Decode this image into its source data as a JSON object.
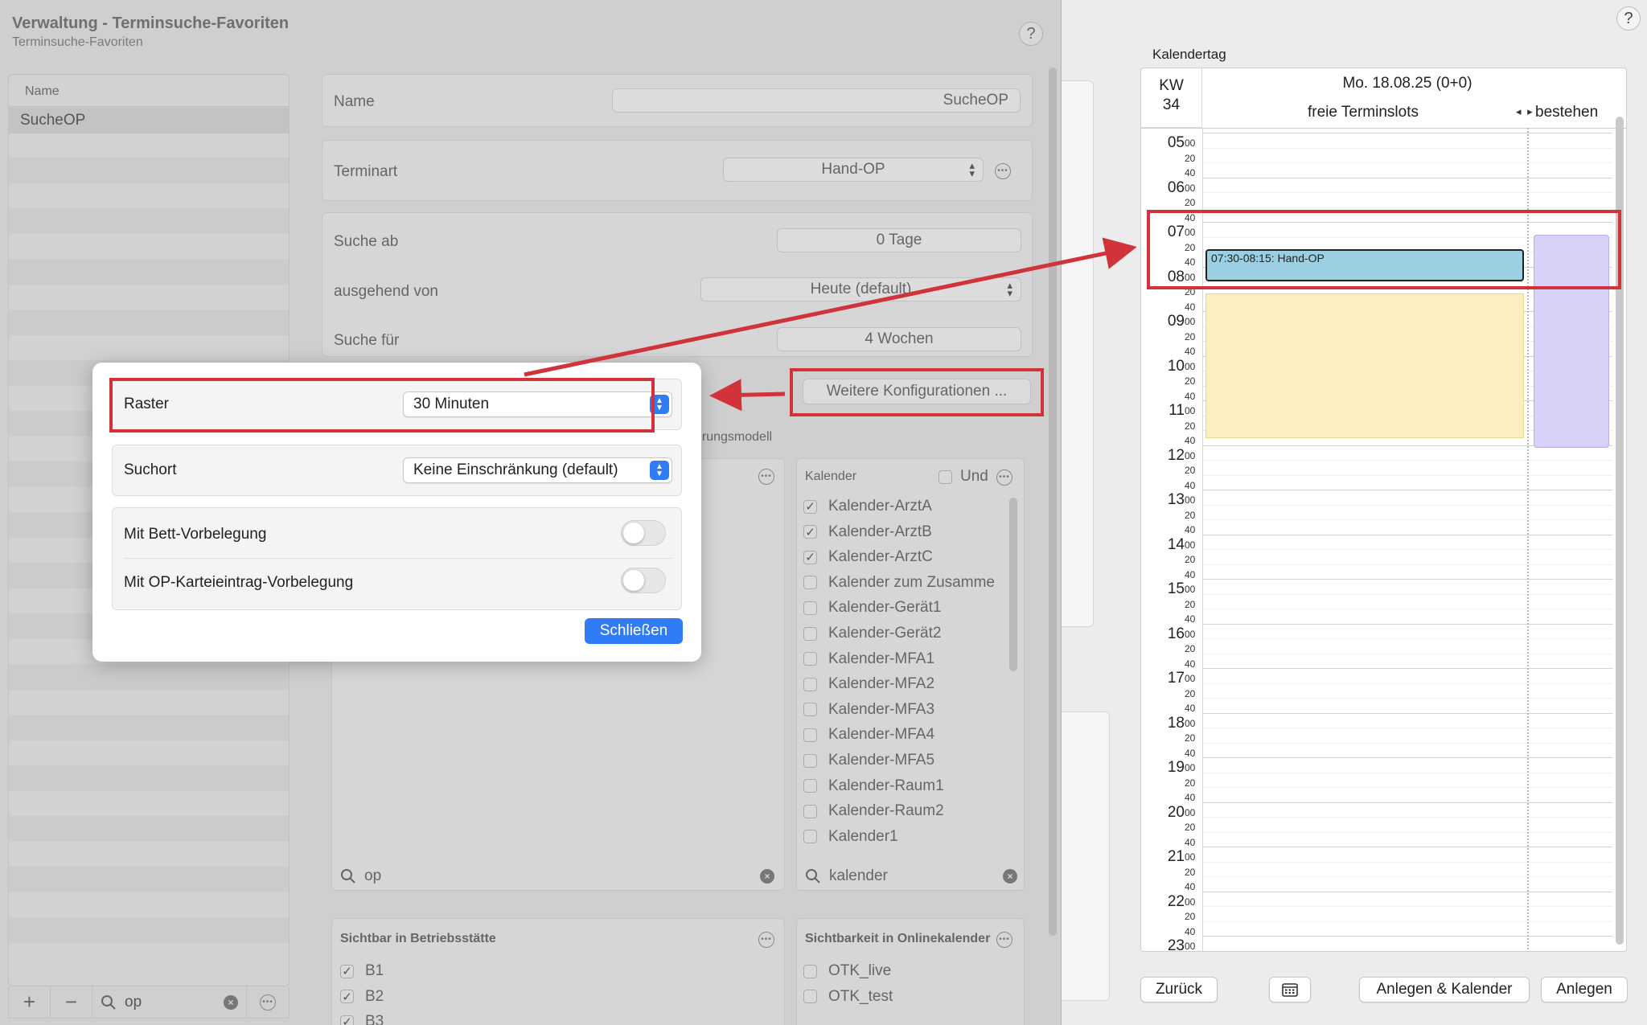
{
  "sheet": {
    "title": "Verwaltung - Terminsuche-Favoriten",
    "subtitle": "Terminsuche-Favoriten",
    "help": "?"
  },
  "list": {
    "header": "Name",
    "selected_item": "SucheOP",
    "search_value": "op",
    "add_label": "+",
    "remove_label": "−"
  },
  "form": {
    "name_label": "Name",
    "name_value": "SucheOP",
    "terminart_label": "Terminart",
    "terminart_value": "Hand-OP",
    "suche_ab_label": "Suche ab",
    "suche_ab_value": "0 Tage",
    "ausgehend_label": "ausgehend von",
    "ausgehend_value": "Heute (default)",
    "suche_fuer_label": "Suche für",
    "suche_fuer_value": "4 Wochen",
    "weitere_button": "Weitere Konfigurationen ...",
    "partial_label": "erungsmodell",
    "left_search_value": "op"
  },
  "kalender": {
    "header": "Kalender",
    "und_label": "Und",
    "items": [
      {
        "label": "Kalender-ArztA",
        "checked": "✓"
      },
      {
        "label": "Kalender-ArztB",
        "checked": "✓"
      },
      {
        "label": "Kalender-ArztC",
        "checked": "✓"
      },
      {
        "label": "Kalender zum Zusamme",
        "checked": ""
      },
      {
        "label": "Kalender-Gerät1",
        "checked": ""
      },
      {
        "label": "Kalender-Gerät2",
        "checked": ""
      },
      {
        "label": "Kalender-MFA1",
        "checked": ""
      },
      {
        "label": "Kalender-MFA2",
        "checked": ""
      },
      {
        "label": "Kalender-MFA3",
        "checked": ""
      },
      {
        "label": "Kalender-MFA4",
        "checked": ""
      },
      {
        "label": "Kalender-MFA5",
        "checked": ""
      },
      {
        "label": "Kalender-Raum1",
        "checked": ""
      },
      {
        "label": "Kalender-Raum2",
        "checked": ""
      },
      {
        "label": "Kalender1",
        "checked": ""
      }
    ],
    "search_value": "kalender"
  },
  "sichtbar": {
    "header": "Sichtbar in Betriebsstätte",
    "items": [
      {
        "label": "B1",
        "checked": "✓"
      },
      {
        "label": "B2",
        "checked": "✓"
      },
      {
        "label": "B3",
        "checked": "✓"
      }
    ]
  },
  "online": {
    "header": "Sichtbarkeit in Onlinekalender",
    "items": [
      {
        "label": "OTK_live",
        "checked": ""
      },
      {
        "label": "OTK_test",
        "checked": ""
      }
    ]
  },
  "popover": {
    "raster_label": "Raster",
    "raster_value": "30 Minuten",
    "suchort_label": "Suchort",
    "suchort_value": "Keine Einschränkung (default)",
    "bett_label": "Mit Bett-Vorbelegung",
    "op_label": "Mit OP-Karteieintrag-Vorbelegung",
    "close_button": "Schließen"
  },
  "calendar": {
    "section_label": "Kalendertag",
    "kw_label": "KW",
    "kw_number": "34",
    "date": "Mo. 18.08.25 (0+0)",
    "col1": "freie Terminslots",
    "col2": "bestehen",
    "arrows": "◂ ▸",
    "hours": [
      "05",
      "06",
      "07",
      "08",
      "09",
      "10",
      "11",
      "12",
      "13",
      "14",
      "15",
      "16",
      "17",
      "18",
      "19",
      "20",
      "21",
      "22",
      "23"
    ],
    "minutes": [
      "00",
      "20",
      "40"
    ],
    "event": "07:30-08:15: Hand-OP"
  },
  "footer": {
    "back": "Zurück",
    "create_calendar": "Anlegen & Kalender",
    "create": "Anlegen"
  },
  "colors": {
    "accent": "#2f7cf6",
    "annotation_red": "#d0333a",
    "event_blue": "#9dcfe2",
    "slot_yellow": "#fbefbf",
    "slot_purple": "#d7d2f7"
  }
}
